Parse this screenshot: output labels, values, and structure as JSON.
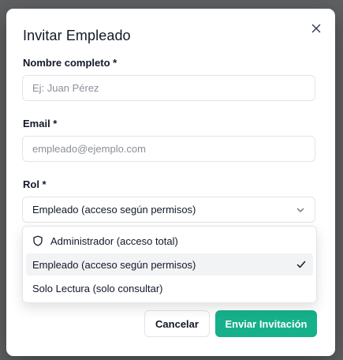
{
  "dialog": {
    "title": "Invitar Empleado",
    "close_icon": "close-icon"
  },
  "form": {
    "name": {
      "label": "Nombre completo *",
      "placeholder": "Ej: Juan Pérez",
      "value": ""
    },
    "email": {
      "label": "Email *",
      "placeholder": "empleado@ejemplo.com",
      "value": ""
    },
    "role": {
      "label": "Rol *",
      "selected": "Empleado (acceso según permisos)"
    }
  },
  "role_options": [
    {
      "label": "Administrador (acceso total)",
      "icon": "shield-icon"
    },
    {
      "label": "Empleado (acceso según permisos)",
      "selected": true,
      "icon": "check-icon"
    },
    {
      "label": "Solo Lectura (solo consultar)"
    }
  ],
  "actions": {
    "cancel_label": "Cancelar",
    "submit_label": "Enviar Invitación"
  },
  "colors": {
    "accent": "#16b08a",
    "border": "#e2e4e8",
    "backdrop": "#5f6062"
  }
}
